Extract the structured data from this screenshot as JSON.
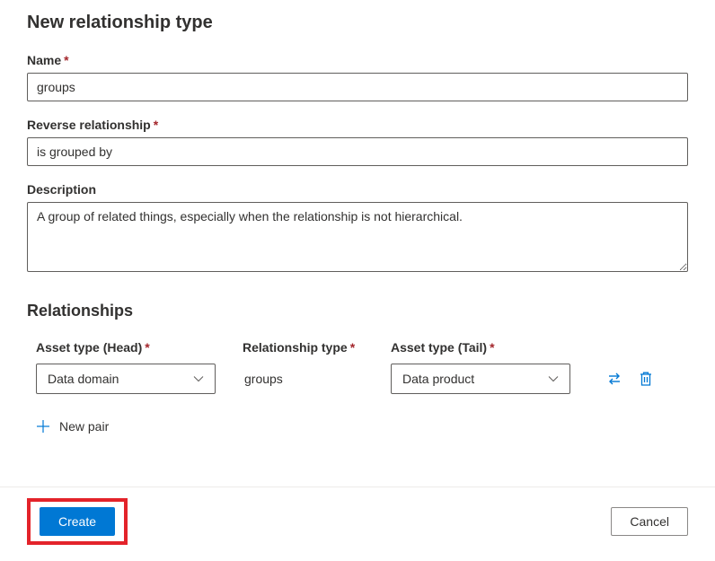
{
  "title": "New relationship type",
  "fields": {
    "name": {
      "label": "Name",
      "value": "groups",
      "required": true
    },
    "reverse": {
      "label": "Reverse relationship",
      "value": "is grouped by",
      "required": true
    },
    "description": {
      "label": "Description",
      "value": "A group of related things, especially when the relationship is not hierarchical.",
      "required": false
    }
  },
  "relationships": {
    "section_title": "Relationships",
    "columns": {
      "head": "Asset type (Head)",
      "type": "Relationship type",
      "tail": "Asset type (Tail)"
    },
    "rows": [
      {
        "head": "Data domain",
        "type": "groups",
        "tail": "Data product"
      }
    ],
    "new_pair_label": "New pair"
  },
  "footer": {
    "create_label": "Create",
    "cancel_label": "Cancel"
  },
  "colors": {
    "accent": "#0078d4",
    "required": "#a4262c",
    "highlight": "#e3232a"
  }
}
